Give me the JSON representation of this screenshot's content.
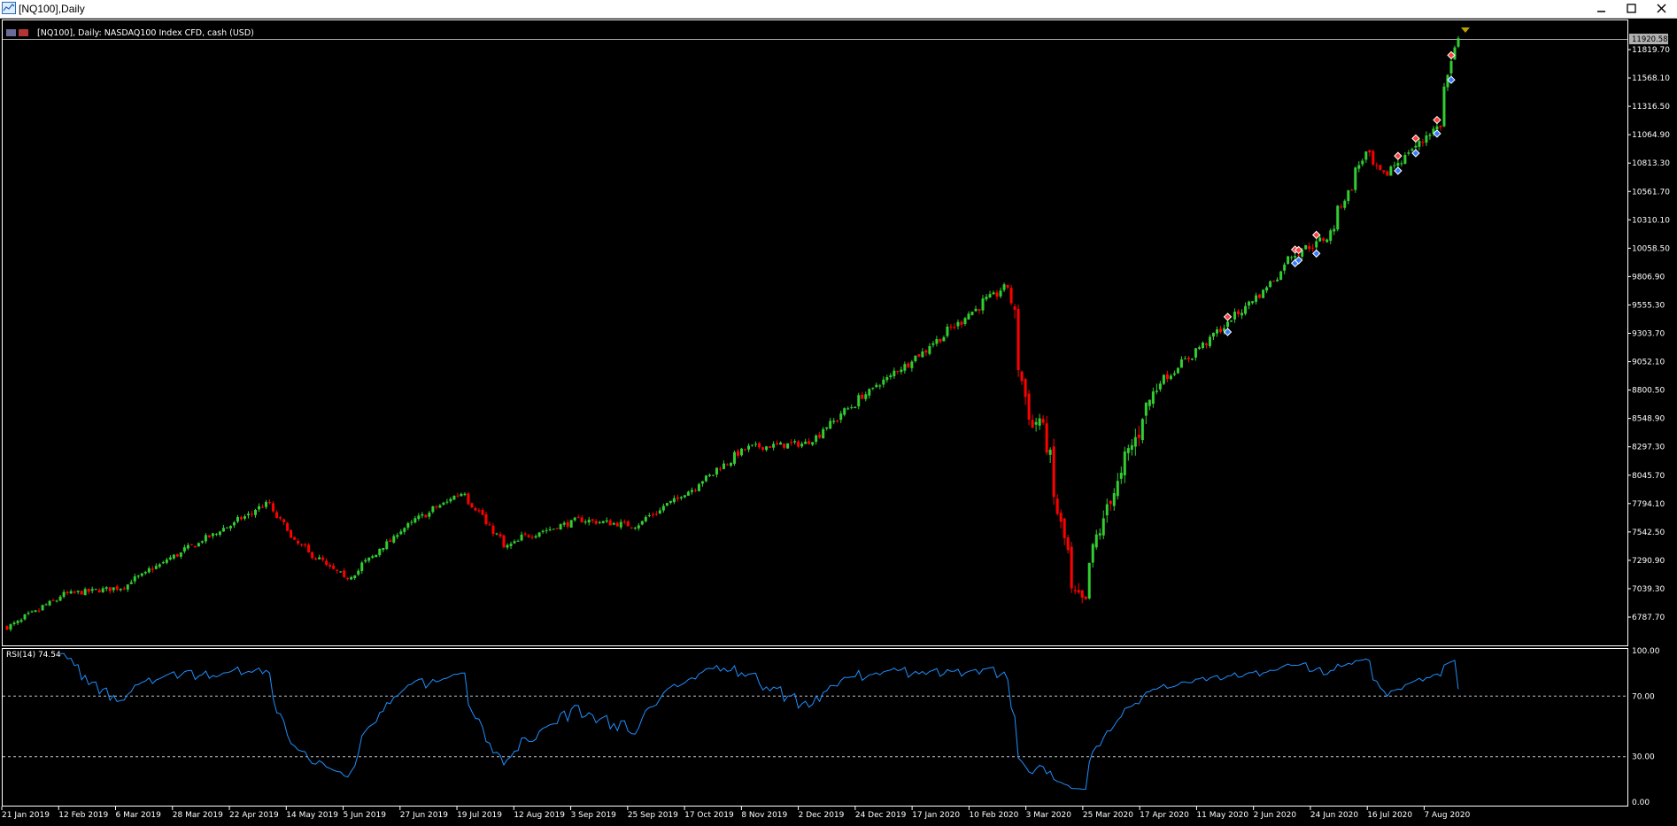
{
  "window": {
    "title": "[NQ100],Daily",
    "controls": [
      "minimize-icon",
      "maximize-icon",
      "close-icon"
    ]
  },
  "main_chart": {
    "header": "[NQ100], Daily:  NASDAQ100 Index CFD, cash (USD)",
    "current_price": "11920.58",
    "price_ticks": [
      "11819.70",
      "11568.10",
      "11316.50",
      "11064.90",
      "10813.30",
      "10561.70",
      "10310.10",
      "10058.50",
      "9806.90",
      "9555.30",
      "9303.70",
      "9052.10",
      "8800.50",
      "8548.90",
      "8297.30",
      "8045.70",
      "7794.10",
      "7542.50",
      "7290.90",
      "7039.30",
      "6787.70"
    ],
    "date_ticks": [
      "21 Jan 2019",
      "12 Feb 2019",
      "6 Mar 2019",
      "28 Mar 2019",
      "22 Apr 2019",
      "14 May 2019",
      "5 Jun 2019",
      "27 Jun 2019",
      "19 Jul 2019",
      "12 Aug 2019",
      "3 Sep 2019",
      "25 Sep 2019",
      "17 Oct 2019",
      "8 Nov 2019",
      "2 Dec 2019",
      "24 Dec 2019",
      "17 Jan 2020",
      "10 Feb 2020",
      "3 Mar 2020",
      "25 Mar 2020",
      "17 Apr 2020",
      "11 May 2020",
      "2 Jun 2020",
      "24 Jun 2020",
      "16 Jul 2020",
      "7 Aug 2020"
    ],
    "colors": {
      "bull": "#32cd32",
      "bear": "#ff0000",
      "axis": "#ffffff",
      "grid_label": "#ffffff"
    }
  },
  "rsi_panel": {
    "label": "RSI(14) 74.54",
    "level_ticks": [
      "100.00",
      "70.00",
      "30.00",
      "0.00"
    ],
    "color": "#1e90ff"
  },
  "chart_data": [
    {
      "type": "candlestick",
      "title": "[NQ100], Daily:  NASDAQ100 Index CFD, cash (USD)",
      "x_range": [
        "21 Jan 2019",
        "14 Aug 2020"
      ],
      "ylim": [
        6620,
        11920.58
      ],
      "last_close": 11920.58,
      "anchors": [
        {
          "x": "21 Jan 2019",
          "close": 6700
        },
        {
          "x": "12 Feb 2019",
          "close": 6990
        },
        {
          "x": "6 Mar 2019",
          "close": 7050
        },
        {
          "x": "28 Mar 2019",
          "close": 7340
        },
        {
          "x": "22 Apr 2019",
          "close": 7650
        },
        {
          "x": "3 May 2019",
          "close": 7800
        },
        {
          "x": "14 May 2019",
          "close": 7450
        },
        {
          "x": "3 Jun 2019",
          "close": 7120
        },
        {
          "x": "27 Jun 2019",
          "close": 7600
        },
        {
          "x": "19 Jul 2019",
          "close": 7900
        },
        {
          "x": "5 Aug 2019",
          "close": 7400
        },
        {
          "x": "12 Aug 2019",
          "close": 7500
        },
        {
          "x": "3 Sep 2019",
          "close": 7650
        },
        {
          "x": "25 Sep 2019",
          "close": 7600
        },
        {
          "x": "17 Oct 2019",
          "close": 7920
        },
        {
          "x": "8 Nov 2019",
          "close": 8290
        },
        {
          "x": "2 Dec 2019",
          "close": 8330
        },
        {
          "x": "24 Dec 2019",
          "close": 8750
        },
        {
          "x": "17 Jan 2020",
          "close": 9150
        },
        {
          "x": "10 Feb 2020",
          "close": 9590
        },
        {
          "x": "19 Feb 2020",
          "close": 9720
        },
        {
          "x": "28 Feb 2020",
          "close": 8460
        },
        {
          "x": "3 Mar 2020",
          "close": 8550
        },
        {
          "x": "16 Mar 2020",
          "close": 7000
        },
        {
          "x": "20 Mar 2020",
          "close": 6900
        },
        {
          "x": "25 Mar 2020",
          "close": 7500
        },
        {
          "x": "17 Apr 2020",
          "close": 8830
        },
        {
          "x": "11 May 2020",
          "close": 9300
        },
        {
          "x": "2 Jun 2020",
          "close": 9750
        },
        {
          "x": "10 Jun 2020",
          "close": 10000
        },
        {
          "x": "24 Jun 2020",
          "close": 10150
        },
        {
          "x": "9 Jul 2020",
          "close": 10900
        },
        {
          "x": "16 Jul 2020",
          "close": 10700
        },
        {
          "x": "7 Aug 2020",
          "close": 11150
        },
        {
          "x": "14 Aug 2020",
          "close": 11920.58
        }
      ]
    },
    {
      "type": "line",
      "title": "RSI(14) 74.54",
      "ylim": [
        0,
        100
      ],
      "levels": [
        30,
        70
      ],
      "last_value": 74.54
    }
  ]
}
